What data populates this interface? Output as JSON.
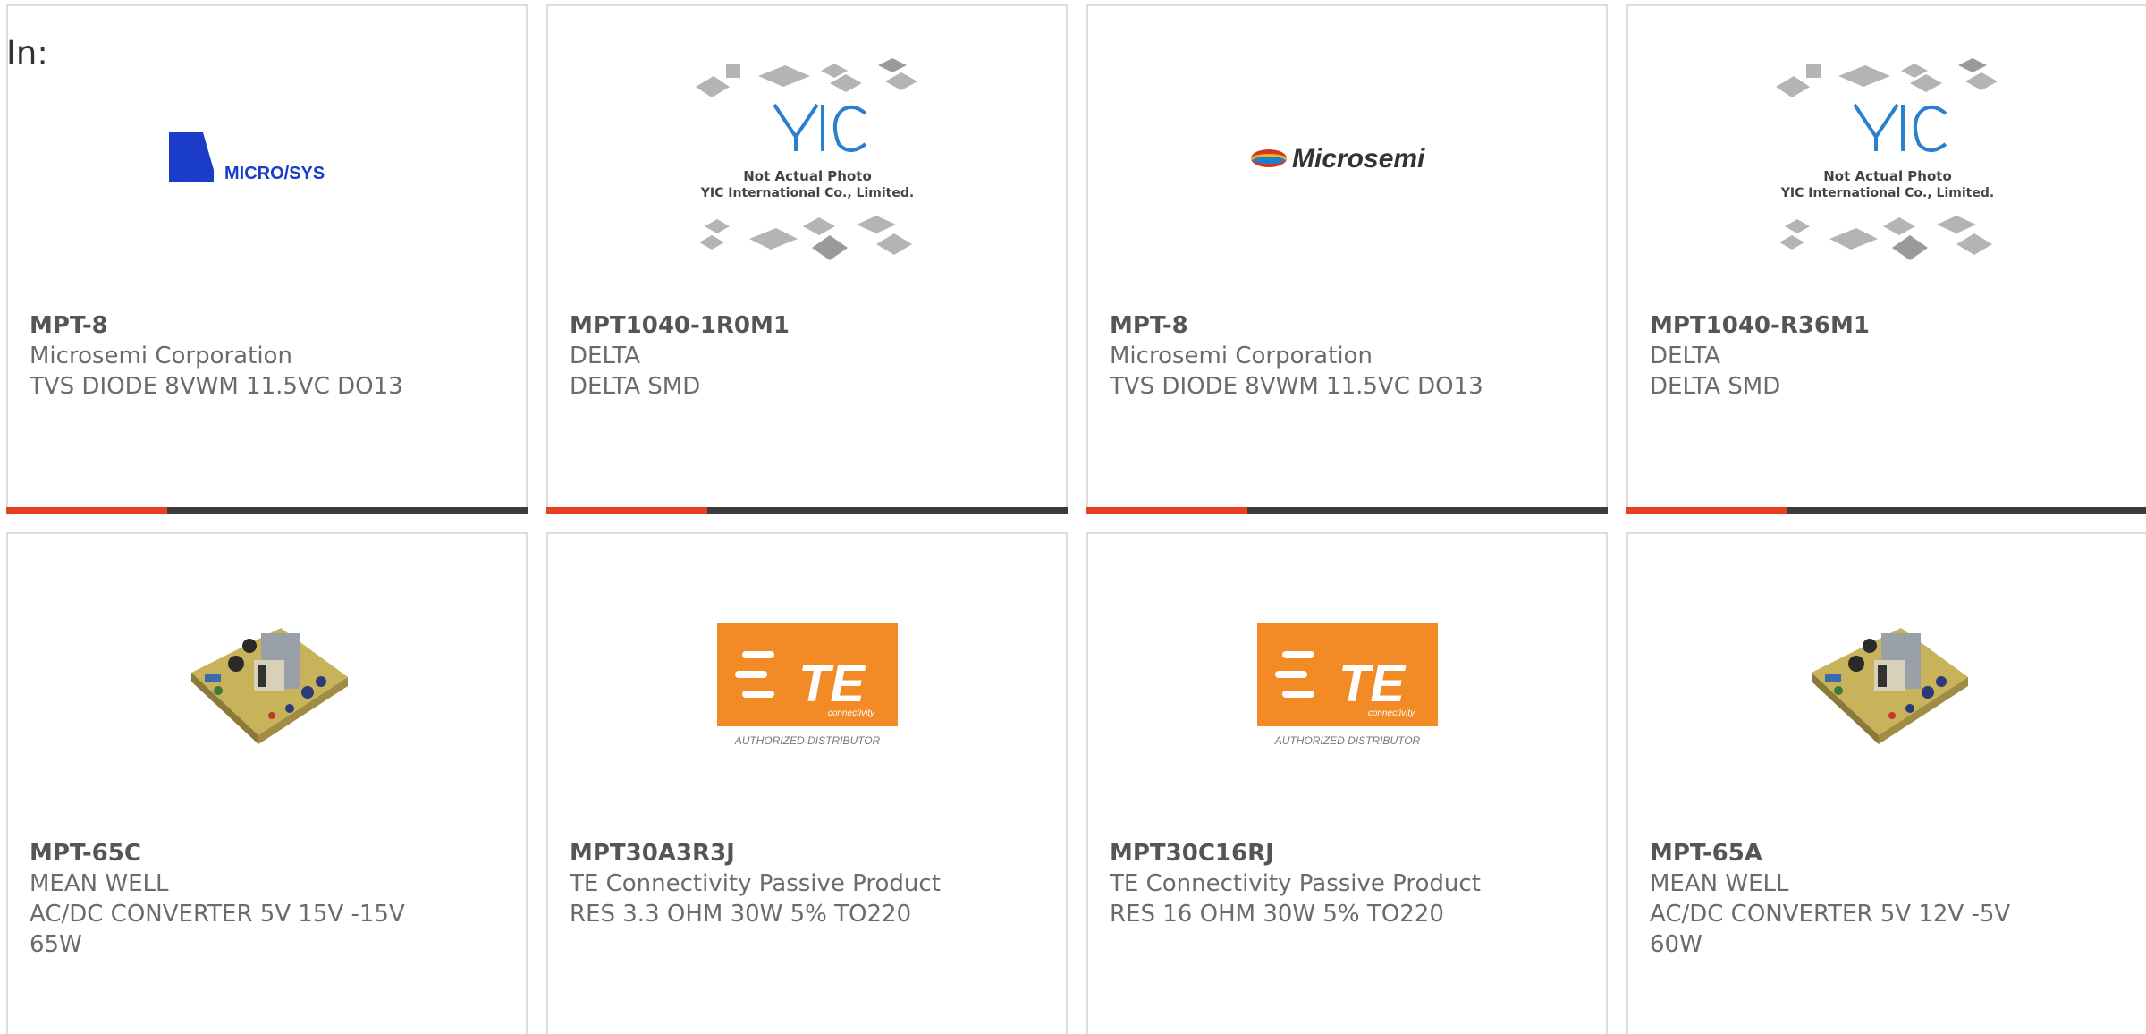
{
  "in_label": "In:",
  "colors": {
    "border": "#dcdcdc",
    "bar_dark": "#3c3c3c",
    "bar_accent": "#e8401e",
    "microsys_blue": "#1a3cc8",
    "te_orange": "#f28a25"
  },
  "cards": [
    {
      "part_number": "MPT-8",
      "manufacturer": "Microsemi Corporation",
      "description": "TVS DIODE 8VWM 11.5VC DO13",
      "image": "micro-sys-logo",
      "logo_text": "MICRO/SYS"
    },
    {
      "part_number": "MPT1040-1R0M1",
      "manufacturer": "DELTA",
      "description": "DELTA SMD",
      "image": "yic-placeholder",
      "logo_text": "YIC",
      "caption1": "Not Actual Photo",
      "caption2": "YIC International Co., Limited."
    },
    {
      "part_number": "MPT-8",
      "manufacturer": "Microsemi Corporation",
      "description": "TVS DIODE 8VWM 11.5VC DO13",
      "image": "microsemi-logo",
      "logo_text": "Microsemi"
    },
    {
      "part_number": "MPT1040-R36M1",
      "manufacturer": "DELTA",
      "description": "DELTA SMD",
      "image": "yic-placeholder",
      "logo_text": "YIC",
      "caption1": "Not Actual Photo",
      "caption2": "YIC International Co., Limited."
    },
    {
      "part_number": "MPT-65C",
      "manufacturer": "MEAN WELL",
      "description": "AC/DC CONVERTER 5V 15V -15V 65W",
      "image": "power-board-photo"
    },
    {
      "part_number": "MPT30A3R3J",
      "manufacturer": "TE Connectivity Passive Product",
      "description": "RES 3.3 OHM 30W 5% TO220",
      "image": "te-logo",
      "logo_text": "TE",
      "logo_sub": "connectivity",
      "logo_caption": "AUTHORIZED DISTRIBUTOR"
    },
    {
      "part_number": "MPT30C16RJ",
      "manufacturer": "TE Connectivity Passive Product",
      "description": "RES 16 OHM 30W 5% TO220",
      "image": "te-logo",
      "logo_text": "TE",
      "logo_sub": "connectivity",
      "logo_caption": "AUTHORIZED DISTRIBUTOR"
    },
    {
      "part_number": "MPT-65A",
      "manufacturer": "MEAN WELL",
      "description": "AC/DC CONVERTER 5V 12V -5V 60W",
      "image": "power-board-photo"
    }
  ]
}
